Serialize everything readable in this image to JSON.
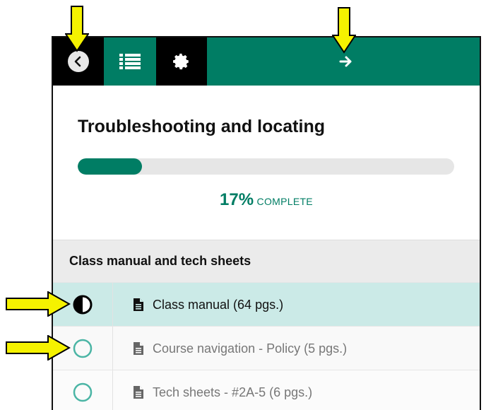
{
  "header": {
    "back_icon": "chevron-left-icon",
    "list_icon": "list-icon",
    "settings_icon": "gear-icon",
    "next_icon": "arrow-right-icon",
    "accent_color": "#007d64"
  },
  "course": {
    "title": "Troubleshooting and locating",
    "progress_fraction": 0.17,
    "percent_text": "17%",
    "complete_label": "COMPLETE"
  },
  "section": {
    "title": "Class manual and tech sheets",
    "items": [
      {
        "label": "Class manual (64 pgs.)",
        "status": "in-progress"
      },
      {
        "label": "Course navigation - Policy (5 pgs.)",
        "status": "not-started"
      },
      {
        "label": "Tech sheets - #2A-5 (6 pgs.)",
        "status": "not-started"
      }
    ]
  },
  "annotations": {
    "arrow_color": "#f5f200"
  }
}
